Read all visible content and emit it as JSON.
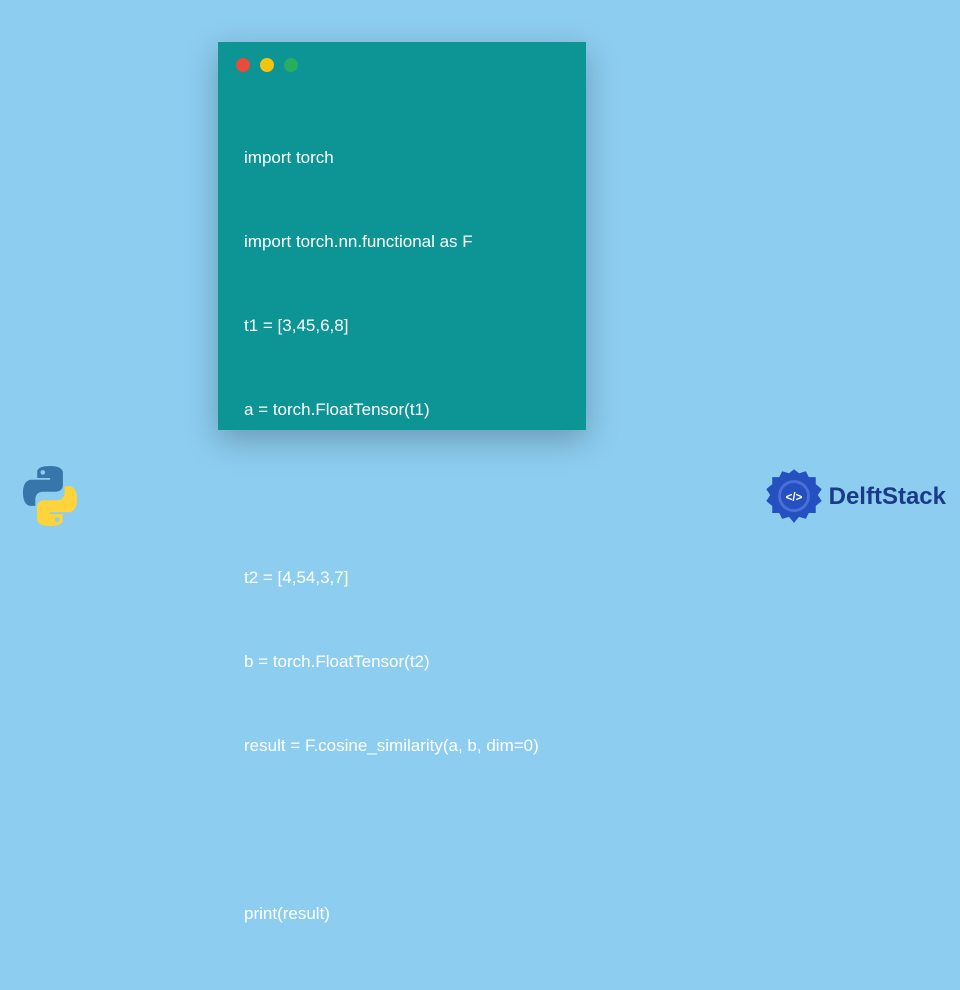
{
  "code": {
    "lines": [
      "import torch",
      "import torch.nn.functional as F",
      "t1 = [3,45,6,8]",
      "a = torch.FloatTensor(t1)",
      "",
      "t2 = [4,54,3,7]",
      "b = torch.FloatTensor(t2)",
      "result = F.cosine_similarity(a, b, dim=0)",
      "",
      "print(result)"
    ]
  },
  "branding": {
    "delftstack": "DelftStack"
  },
  "colors": {
    "background": "#8dcdf0",
    "codeWindow": "#0d9494",
    "dotRed": "#e74c3c",
    "dotYellow": "#f1c40f",
    "dotGreen": "#27ae60",
    "delftText": "#1a3a8a"
  }
}
